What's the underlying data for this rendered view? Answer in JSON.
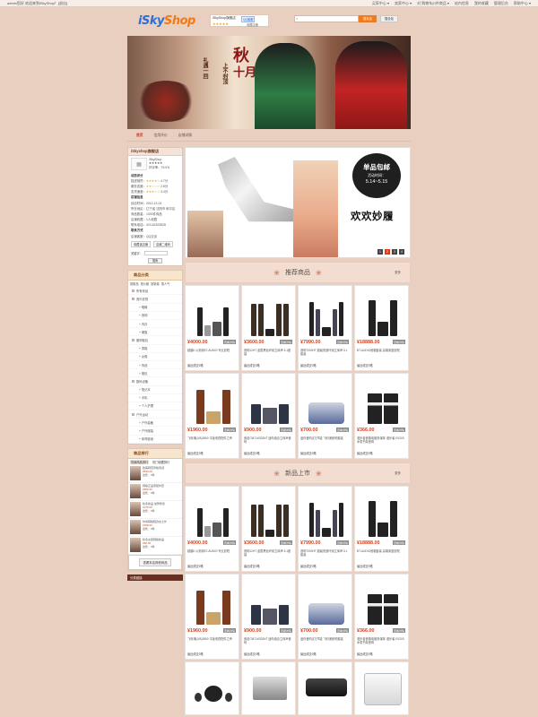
{
  "topbar": {
    "welcome": "admin您好 欢迎来到iSkyShop！[退出]",
    "links": [
      "买家中心 ▾",
      "卖家中心 ▾",
      "对 购物车(0件商品 ▾",
      "站内信息",
      "我的收藏",
      "管理后台",
      "帮助中心 ▾"
    ]
  },
  "header": {
    "logo_main": "iSky",
    "logo_sub": "Shop",
    "shop_name": "iSkyShop旗舰店",
    "qq_label": "QQ客服",
    "stars": "★★★★★",
    "fav_label": "收藏店铺",
    "search_btn": "搜本店",
    "search_btn2": "搜全站"
  },
  "banner": {
    "c1": "秋",
    "c2": "十月",
    "c3": "上不封顶",
    "c4": "礼遇一回"
  },
  "nav": {
    "items": [
      "首页",
      "信用评价",
      "店铺详情"
    ]
  },
  "shop_info": {
    "title": "iSkyshop旗舰店",
    "owner": "iSkyShop",
    "stars": "★★★★★",
    "rate_label": "好评率：75.0%",
    "dyn_title": "动态评分",
    "scores": [
      {
        "label": "描述相符：",
        "stars": "★★★★☆",
        "val": "4.7分"
      },
      {
        "label": "服务态度：",
        "stars": "★★☆☆☆",
        "val": "2.8分"
      },
      {
        "label": "发货速度：",
        "stars": "★★★☆☆",
        "val": "3.4分"
      }
    ],
    "info_title": "店铺信息",
    "info_rows": [
      "创店时间：2012-12-24",
      "所在地区：辽宁省 沈阳市 和平区",
      "商品数量：1000件商品",
      "店铺收藏：1人收藏",
      "联系电话：024-62323528"
    ],
    "contact_title": "联系方式",
    "contact_row": "店铺客服：QQ交谈",
    "fav_btn": "收藏该店铺",
    "qr_btn": "店铺二维码",
    "kw_label": "关键字：",
    "search_btn": "搜索"
  },
  "categories": {
    "title": "商品分类",
    "tabs": [
      "按新品",
      "按价格",
      "按销量",
      "按人气"
    ],
    "items": [
      {
        "label": "所有商品",
        "sub": false
      },
      {
        "label": "音乐影视",
        "sub": false
      },
      {
        "label": "唱碟",
        "sub": true
      },
      {
        "label": "音响",
        "sub": true
      },
      {
        "label": "内存",
        "sub": true
      },
      {
        "label": "硬盘",
        "sub": true
      },
      {
        "label": "服饰鞋包",
        "sub": false
      },
      {
        "label": "男鞋",
        "sub": true
      },
      {
        "label": "女鞋",
        "sub": true
      },
      {
        "label": "饰品",
        "sub": true
      },
      {
        "label": "帽包",
        "sub": true
      },
      {
        "label": "数码设备",
        "sub": false
      },
      {
        "label": "笔记本",
        "sub": true
      },
      {
        "label": "手机",
        "sub": true
      },
      {
        "label": "个人护理",
        "sub": true
      },
      {
        "label": "户外运动",
        "sub": false
      },
      {
        "label": "户外装备",
        "sub": true
      },
      {
        "label": "户外服装",
        "sub": true
      },
      {
        "label": "体育健身",
        "sub": true
      }
    ]
  },
  "ranking": {
    "title": "商品排行",
    "tabs": [
      "热销商品排行",
      "热门收藏排行"
    ],
    "items": [
      {
        "name": "欧美韩范风格毛领",
        "price": "¥696.00",
        "stat": "出售：0件"
      },
      {
        "name": "韩版正品男装外套",
        "price": "¥680.00",
        "stat": "出售：0件"
      },
      {
        "name": "秋冬新品 加厚修身",
        "price": "¥276.00",
        "stat": "出售：0件"
      },
      {
        "name": "时尚韩版短款女士外",
        "price": "¥208.00",
        "stat": "出售：0件"
      },
      {
        "name": "秋冬女装韩版新品",
        "price": "¥98.00",
        "stat": "出售：0件"
      }
    ],
    "more_btn": "查看本店其他商品",
    "dark_label": "分类链接"
  },
  "slide": {
    "bubble_t1": "单品包邮",
    "bubble_t2": "活动时间：",
    "bubble_t3": "5.14~5.15",
    "big_text": "欢欢妙履",
    "pager": [
      "1",
      "2",
      "3",
      "4"
    ]
  },
  "sections": [
    {
      "title": "推荐商品",
      "more": "更多"
    },
    {
      "title": "新品上市",
      "more": "更多"
    }
  ],
  "products": [
    {
      "price": "¥4000.00",
      "tag": "查看详情",
      "name": "超越Ⅱ 公务用BT-AUDIO 专业影院",
      "sold": "最近成交0笔",
      "kind": "tower"
    },
    {
      "price": "¥3600.00",
      "tag": "查看详情",
      "name": "音响12HT 金属黑色环绕立体声 5.1套装",
      "sold": "最近成交0笔",
      "kind": "tower2"
    },
    {
      "price": "¥7990.00",
      "tag": "查看详情",
      "name": "音响7000HT 超级低音环绕立体声 5.1套装",
      "sold": "最近成交0笔",
      "kind": "tower3"
    },
    {
      "price": "¥18888.00",
      "tag": "查看详情",
      "name": "BT-AUDIO音箱套装 高端家庭影院",
      "sold": "最近成交0笔",
      "kind": "tower4"
    },
    {
      "price": "¥1960.00",
      "tag": "查看详情",
      "name": "飞利浦(LIB)3650 平板电视配件之声",
      "sold": "最近成交0笔",
      "kind": "wood"
    },
    {
      "price": "¥900.00",
      "tag": "查看详情",
      "name": "索尼CMT-M333NT 迷你组合立体声音响",
      "sold": "最近成交0笔",
      "kind": "mini"
    },
    {
      "price": "¥700.00",
      "tag": "查看详情",
      "name": "迷你音响(灯)节能 飞利浦音响套装",
      "sold": "最近成交0笔",
      "kind": "silver"
    },
    {
      "price": "¥366.00",
      "tag": "查看详情",
      "name": "漫步者音箱电脑多媒体 漫步者 R1200 木质书架音响",
      "sold": "最近成交0笔",
      "kind": "bw"
    }
  ],
  "products_new": [
    {
      "price": "¥4000.00",
      "tag": "查看详情",
      "name": "超越Ⅱ 公务用BT-AUDIO 专业影院",
      "sold": "最近成交0笔",
      "kind": "tower"
    },
    {
      "price": "¥3600.00",
      "tag": "查看详情",
      "name": "音响12HT 金属黑色环绕立体声 5.1套装",
      "sold": "最近成交0笔",
      "kind": "tower2"
    },
    {
      "price": "¥7990.00",
      "tag": "查看详情",
      "name": "音响7000HT 超级低音环绕立体声 5.1套装",
      "sold": "最近成交0笔",
      "kind": "tower3"
    },
    {
      "price": "¥18888.00",
      "tag": "查看详情",
      "name": "BT-AUDIO音箱套装 高端家庭影院",
      "sold": "最近成交0笔",
      "kind": "tower4"
    },
    {
      "price": "¥1960.00",
      "tag": "查看详情",
      "name": "飞利浦(LIB)3650 平板电视配件之声",
      "sold": "最近成交0笔",
      "kind": "wood"
    },
    {
      "price": "¥900.00",
      "tag": "查看详情",
      "name": "索尼CMT-M333NT 迷你组合立体声音响",
      "sold": "最近成交0笔",
      "kind": "mini"
    },
    {
      "price": "¥700.00",
      "tag": "查看详情",
      "name": "迷你音响(灯)节能 飞利浦音响套装",
      "sold": "最近成交0笔",
      "kind": "silver"
    },
    {
      "price": "¥366.00",
      "tag": "查看详情",
      "name": "漫步者音箱电脑多媒体 漫步者 R1200 木质书架音响",
      "sold": "最近成交0笔",
      "kind": "bw"
    }
  ],
  "colors": {
    "accent": "#e43b12",
    "brand": "#2b6fd6",
    "logo_orange": "#f07a13",
    "bg": "#e9cfc0"
  }
}
